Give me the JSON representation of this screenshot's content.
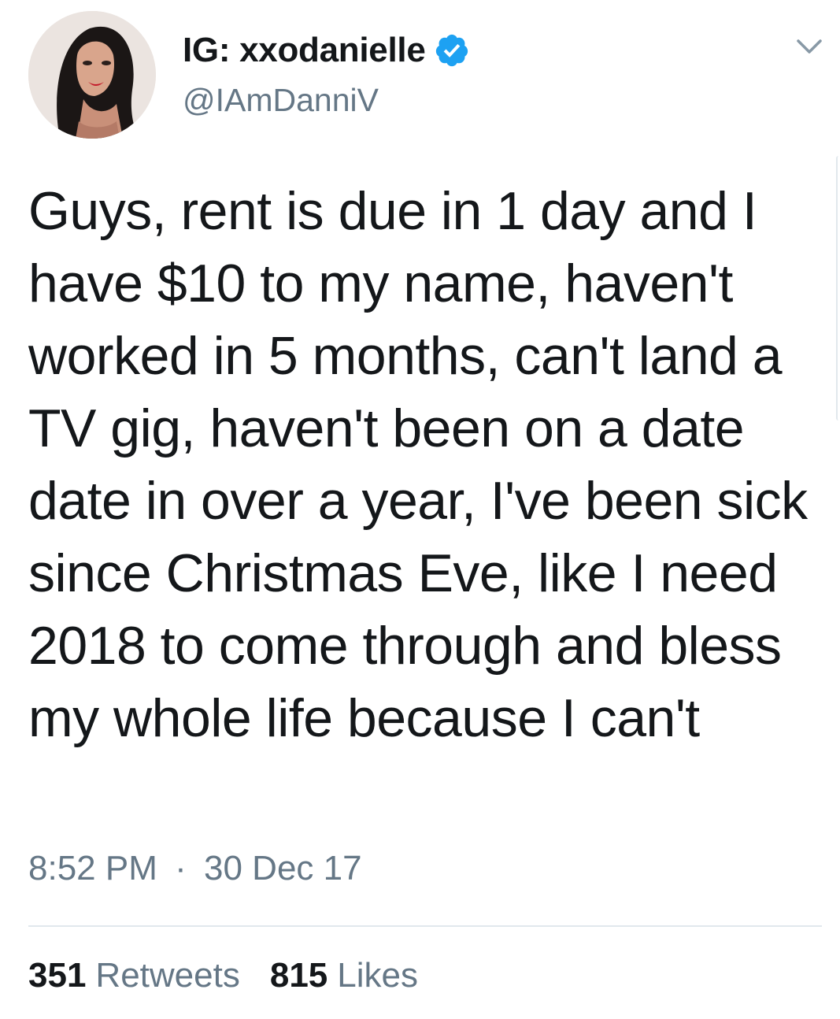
{
  "tweet": {
    "display_name": "IG: xxodanielle",
    "handle": "@IAmDanniV",
    "verified": true,
    "text": "Guys, rent is due in 1 day and I have $10 to my name, haven't worked in 5 months, can't land a TV gig, haven't been on a date date in over a year, I've been sick since Christmas Eve, like I need 2018 to come through and bless my whole life because I can't",
    "time": "8:52 PM",
    "separator": "·",
    "date": "30 Dec 17",
    "retweets_count": "351",
    "retweets_label": "Retweets",
    "likes_count": "815",
    "likes_label": "Likes"
  },
  "icons": {
    "avatar": "profile-photo",
    "verified": "verified-badge-icon",
    "menu": "chevron-down-icon"
  },
  "colors": {
    "text_primary": "#14171a",
    "text_secondary": "#657786",
    "verified_blue": "#1da1f2",
    "divider": "#e1e8ed"
  }
}
